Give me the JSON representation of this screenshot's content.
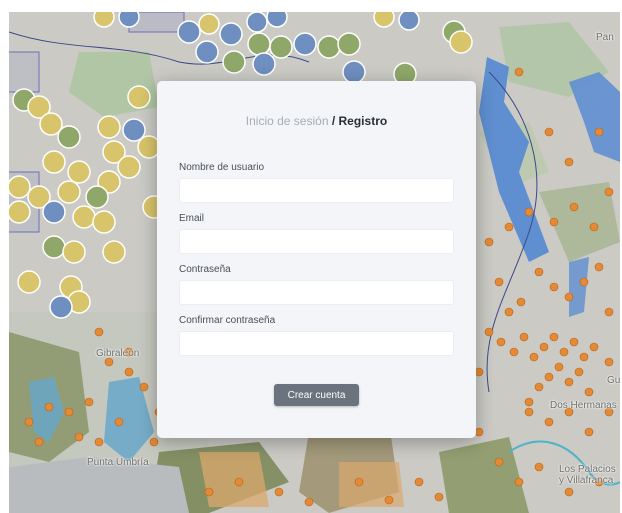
{
  "map": {
    "labels": [
      "Pan",
      "Gibraleón",
      "Punta Umbría",
      "Dos Hermanas",
      "Gu",
      "Los Palacios y Villafranca"
    ]
  },
  "auth": {
    "title_login": "Inicio de sesión",
    "title_separator": " / ",
    "title_register": "Registro",
    "fields": [
      {
        "label": "Nombre de usuario",
        "value": "",
        "placeholder": ""
      },
      {
        "label": "Email",
        "value": "",
        "placeholder": ""
      },
      {
        "label": "Contraseña",
        "value": "",
        "placeholder": ""
      },
      {
        "label": "Confirmar contraseña",
        "value": "",
        "placeholder": ""
      }
    ],
    "submit_label": "Crear cuenta"
  },
  "colors": {
    "modal_bg": "#f3f5f8",
    "button_bg": "#6b747e",
    "marker_blue": "#6f8fc0",
    "marker_yellow": "#d8c46a",
    "marker_green": "#8fa86a",
    "dot_orange": "#e48a36",
    "water": "#5f8fd0"
  },
  "icons": [
    "map-marker-icon",
    "factory-icon",
    "tools-icon",
    "person-icon",
    "warehouse-icon"
  ]
}
